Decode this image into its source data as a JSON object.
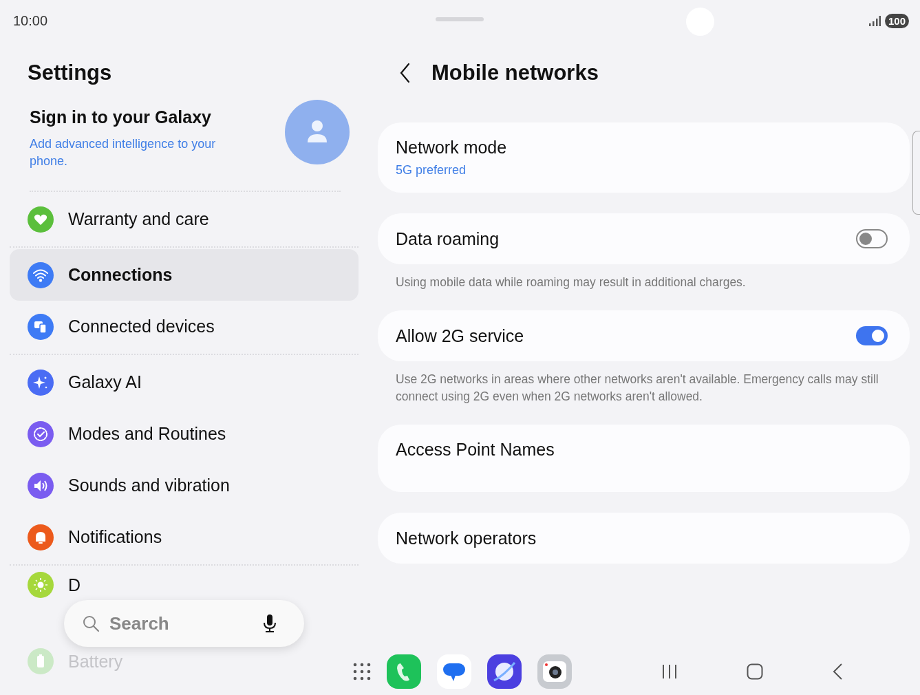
{
  "status_bar": {
    "time": "10:00",
    "battery": "100"
  },
  "sidebar": {
    "title": "Settings",
    "account": {
      "title": "Sign in to your Galaxy",
      "subtitle": "Add advanced intelligence to your phone."
    },
    "groups": [
      [
        {
          "color": "#5bbf3c",
          "label": "Warranty and care",
          "selected": false,
          "faded": false
        }
      ],
      [
        {
          "color": "#3e7bf5",
          "label": "Connections",
          "selected": true,
          "faded": false
        },
        {
          "color": "#3e7bf5",
          "label": "Connected devices",
          "selected": false,
          "faded": false
        }
      ],
      [
        {
          "color": "#4a6cf4",
          "label": "Galaxy AI",
          "selected": false,
          "faded": false
        },
        {
          "color": "#7a5cf0",
          "label": "Modes and Routines",
          "selected": false,
          "faded": false
        },
        {
          "color": "#7a5cf0",
          "label": "Sounds and vibration",
          "selected": false,
          "faded": false
        },
        {
          "color": "#ec5a1c",
          "label": "Notifications",
          "selected": false,
          "faded": false
        }
      ],
      [
        {
          "color": "#a6d83c",
          "label": "D",
          "selected": false,
          "faded": false
        },
        {
          "color": "#cbe9c6",
          "label": "Battery",
          "selected": false,
          "faded": true
        }
      ]
    ]
  },
  "search": {
    "placeholder": "Search"
  },
  "page": {
    "title": "Mobile networks",
    "items": [
      {
        "kind": "link",
        "title": "Network mode",
        "value": "5G preferred",
        "tall": false
      },
      {
        "kind": "toggle",
        "title": "Data roaming",
        "on": false,
        "note": "Using mobile data while roaming may result in additional charges."
      },
      {
        "kind": "toggle",
        "title": "Allow 2G service",
        "on": true,
        "note": "Use 2G networks in areas where other networks aren't available. Emergency calls may still connect using 2G even when 2G networks aren't allowed."
      },
      {
        "kind": "link",
        "title": "Access Point Names",
        "tall": true
      },
      {
        "kind": "link",
        "title": "Network operators",
        "tall": false
      }
    ]
  }
}
